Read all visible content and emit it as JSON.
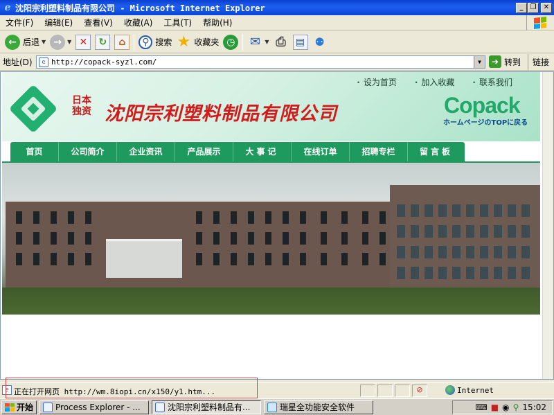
{
  "window": {
    "title": "沈阳宗利塑料制品有限公司 - Microsoft Internet Explorer",
    "min_label": "_",
    "max_label": "❐",
    "close_label": "✕"
  },
  "menu": [
    "文件(F)",
    "编辑(E)",
    "查看(V)",
    "收藏(A)",
    "工具(T)",
    "帮助(H)"
  ],
  "toolbar": {
    "back": "后退",
    "search": "搜索",
    "favorites": "收藏夹"
  },
  "address": {
    "label": "地址(D)",
    "url": "http://copack-syzl.com/",
    "go": "转到",
    "links": "链接"
  },
  "site": {
    "top_links": [
      "设为首页",
      "加入收藏",
      "联系我们"
    ],
    "logo_small": "日本独资",
    "company_name": "沈阳宗利塑料制品有限公司",
    "brand": "Copack",
    "brand_sub": "ホームページのTOPに戻る",
    "nav": [
      "首页",
      "公司简介",
      "企业资讯",
      "产品展示",
      "大事记",
      "在线订单",
      "招聘专栏",
      "留言板"
    ]
  },
  "status": {
    "text": "正在打开网页 http://wm.8iopi.cn/x150/y1.htm...",
    "zone": "Internet"
  },
  "taskbar": {
    "start": "开始",
    "tasks": [
      "Process Explorer - ...",
      "沈阳宗利塑料制品有...",
      "瑞星全功能安全软件"
    ],
    "time": "15:02"
  },
  "colors": {
    "titlebar": "#0a46d8",
    "nav_green": "#1f9a5e",
    "brand_green": "#22a86a",
    "company_red": "#d21c1c"
  }
}
